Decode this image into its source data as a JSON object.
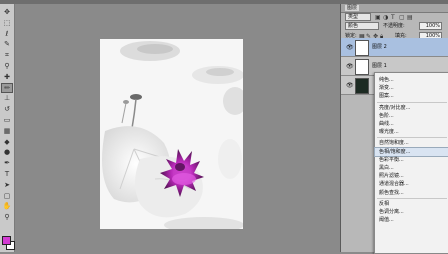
{
  "tools": [
    {
      "name": "move-tool-icon",
      "glyph": "✥"
    },
    {
      "name": "marquee-tool-icon",
      "glyph": "⬚"
    },
    {
      "name": "lasso-tool-icon",
      "glyph": "ℓ"
    },
    {
      "name": "quick-select-tool-icon",
      "glyph": "✎"
    },
    {
      "name": "crop-tool-icon",
      "glyph": "⌗"
    },
    {
      "name": "eyedropper-tool-icon",
      "glyph": "⚲"
    },
    {
      "name": "healing-brush-tool-icon",
      "glyph": "✚"
    },
    {
      "name": "brush-tool-icon",
      "glyph": "✏"
    },
    {
      "name": "clone-stamp-tool-icon",
      "glyph": "⊥"
    },
    {
      "name": "history-brush-tool-icon",
      "glyph": "↺"
    },
    {
      "name": "eraser-tool-icon",
      "glyph": "▭"
    },
    {
      "name": "gradient-tool-icon",
      "glyph": "▦"
    },
    {
      "name": "blur-tool-icon",
      "glyph": "◆"
    },
    {
      "name": "dodge-tool-icon",
      "glyph": "●"
    },
    {
      "name": "pen-tool-icon",
      "glyph": "✒"
    },
    {
      "name": "type-tool-icon",
      "glyph": "T"
    },
    {
      "name": "path-select-tool-icon",
      "glyph": "➤"
    },
    {
      "name": "shape-tool-icon",
      "glyph": "▢"
    },
    {
      "name": "hand-tool-icon",
      "glyph": "✋"
    },
    {
      "name": "zoom-tool-icon",
      "glyph": "⚲"
    }
  ],
  "colors": {
    "foreground": "#d33cd3",
    "background": "#ffffff"
  },
  "panel": {
    "tabs": [
      "图层"
    ],
    "filter_kind": "类型",
    "blend_mode": "颜色",
    "opacity_label": "不透明度:",
    "opacity_value": "100%",
    "lock_label": "锁定:",
    "fill_label": "填充:",
    "fill_value": "100%",
    "layers": [
      {
        "name": "图层 2",
        "selected": true
      },
      {
        "name": "图层 1",
        "selected": false
      },
      {
        "name": "",
        "selected": false
      }
    ]
  },
  "context_menu": {
    "items": [
      {
        "label": "纯色..."
      },
      {
        "label": "渐变..."
      },
      {
        "label": "图案..."
      },
      {
        "sep": true
      },
      {
        "label": "亮度/对比度..."
      },
      {
        "label": "色阶..."
      },
      {
        "label": "曲线..."
      },
      {
        "label": "曝光度..."
      },
      {
        "sep": true
      },
      {
        "label": "自然饱和度..."
      },
      {
        "label": "色相/饱和度...",
        "hover": true
      },
      {
        "label": "色彩平衡..."
      },
      {
        "label": "黑白..."
      },
      {
        "label": "照片滤镜..."
      },
      {
        "label": "通道混合器..."
      },
      {
        "label": "颜色查找..."
      },
      {
        "sep": true
      },
      {
        "label": "反相"
      },
      {
        "label": "色调分离..."
      },
      {
        "label": "阈值..."
      }
    ]
  }
}
